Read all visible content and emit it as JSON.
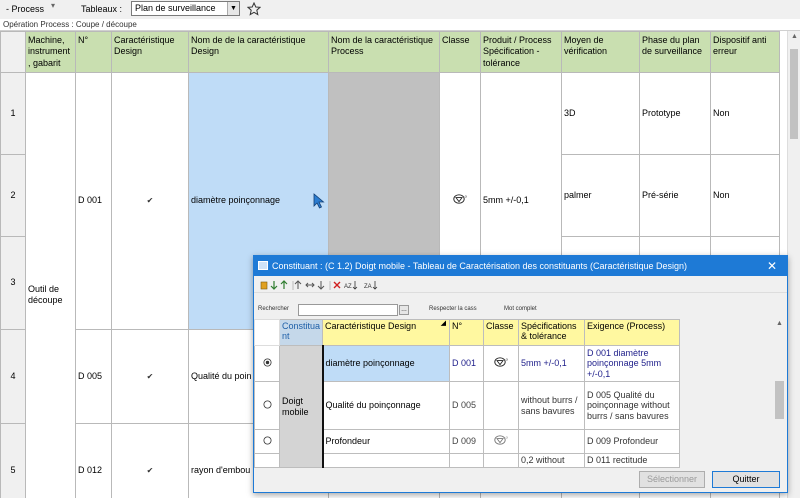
{
  "toolbar": {
    "process_label": "- Process",
    "tableaux_label": "Tableaux :",
    "tableaux_value": "Plan de surveillance",
    "pin_icon": "pin-icon"
  },
  "breadcrumb": "Opération Process : Coupe / découpe",
  "grid": {
    "headers": [
      "Machine, instrument , gabarit",
      "N°",
      "Caractéristique Design",
      "Nom de de la caractéristique Design",
      "Nom de la caractéristique Process",
      "Classe",
      "Produit / Process Spécification - tolérance",
      "Moyen de vérification",
      "Phase du plan de surveillance",
      "Dispositif anti erreur"
    ],
    "row_numbers": [
      "1",
      "2",
      "3",
      "4",
      "5"
    ],
    "machine": "Outil de découpe",
    "features": [
      {
        "num": "D 001",
        "check": "✔",
        "name": "diamètre poinçonnage",
        "classe_icon": "diamond-class-icon",
        "spec": "5mm +/-0,1"
      },
      {
        "num": "D 005",
        "check": "✔",
        "name": "Qualité du poin"
      },
      {
        "num": "D 012",
        "check": "✔",
        "name": "rayon d'embou"
      }
    ],
    "verif_rows": [
      {
        "moyen": "3D",
        "phase": "Prototype",
        "anti": "Non"
      },
      {
        "moyen": "palmer",
        "phase": "Pré-série",
        "anti": "Non"
      }
    ]
  },
  "dialog": {
    "title": "Constituant : (C 1.2) Doigt mobile  -  Tableau de Caractérisation des constituants  (Caractéristique Design)",
    "close": "✕",
    "search_label": "Rechercher",
    "respect_case": "Respecter la cass",
    "mot_complet": "Mot complet",
    "headers": [
      "Constitua nt",
      "Caractéristique Design",
      "N°",
      "Classe",
      "Spécifications & tolérance",
      "Exigence (Process)"
    ],
    "constituant": "Doigt mobile",
    "rows": [
      {
        "selected": true,
        "car": "diamètre poinçonnage",
        "num": "D 001",
        "has_classe": true,
        "spec": "5mm +/-0,1",
        "exig": "D 001 diamètre poinçonnage 5mm +/-0,1"
      },
      {
        "selected": false,
        "car": "Qualité du poinçonnage",
        "num": "D 005",
        "has_classe": false,
        "spec": "without burrs / sans bavures",
        "exig": "D 005 Qualité du poinçonnage without burrs / sans bavures"
      },
      {
        "selected": false,
        "car": "Profondeur",
        "num": "D 009",
        "has_classe": true,
        "spec": "",
        "exig": "D 009 Profondeur"
      },
      {
        "selected": false,
        "car": "",
        "num": "",
        "has_classe": false,
        "spec": "0,2 without",
        "exig": "D 011 rectitude"
      }
    ],
    "btn_select": "Sélectionner",
    "btn_quit": "Quitter"
  },
  "colors": {
    "header_green": "#c9dfb0",
    "selected_blue": "#bfdcf7",
    "process_gray": "#c0c0c0",
    "dialog_blue": "#1e7ad6",
    "inner_header_yellow": "#fff8a0",
    "constituant_gray": "#d4d4d4"
  }
}
